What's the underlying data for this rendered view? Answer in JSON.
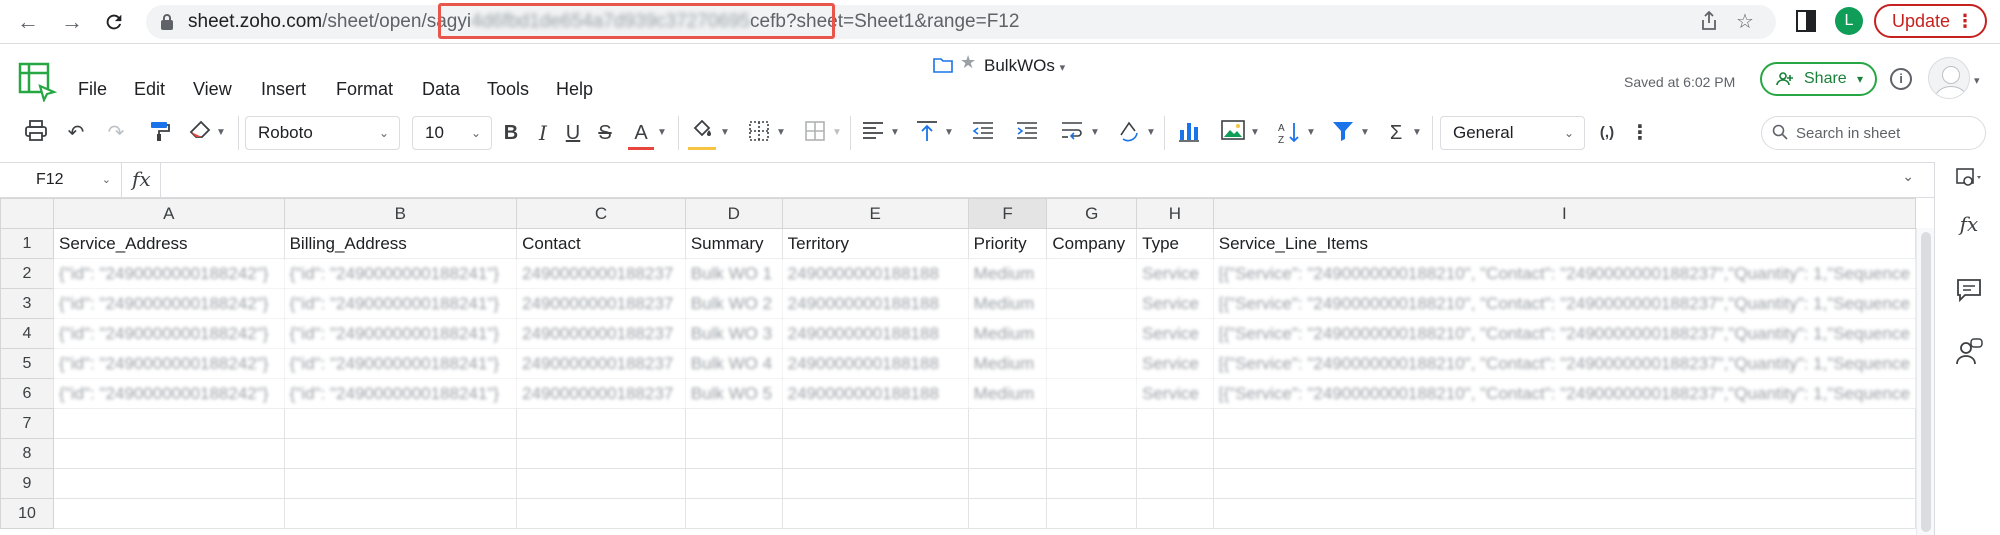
{
  "browser": {
    "url_host": "sheet.zoho.com",
    "url_path": "/sheet/open/",
    "url_id_visible_start": "sagyi",
    "url_id_blurred": "4d6fbd1de654a7d939c37270695",
    "url_id_visible_end": "cefb",
    "url_query": "?sheet=Sheet1&range=F12",
    "profile_initial": "L",
    "update_label": "Update",
    "highlight_color": "#e8564b"
  },
  "app": {
    "doc_title": "BulkWOs",
    "saved_status": "Saved at 6:02 PM",
    "share_label": "Share",
    "brand_color": "#27a744",
    "menu": [
      "File",
      "Edit",
      "View",
      "Insert",
      "Format",
      "Data",
      "Tools",
      "Help"
    ]
  },
  "toolbar": {
    "font_name": "Roboto",
    "font_size": "10",
    "number_format": "General",
    "search_placeholder": "Search in sheet",
    "icons": [
      "print-icon",
      "undo-icon",
      "redo-icon",
      "format-painter-icon",
      "clear-format-icon",
      "bold-icon",
      "italic-icon",
      "underline-icon",
      "strikethrough-icon",
      "text-color-icon",
      "fill-color-icon",
      "borders-icon",
      "merge-cells-icon",
      "align-horizontal-icon",
      "align-vertical-icon",
      "decrease-indent-icon",
      "increase-indent-icon",
      "text-wrap-icon",
      "rotate-text-icon",
      "insert-chart-icon",
      "insert-image-icon",
      "sort-icon",
      "filter-icon",
      "autosum-icon",
      "thousand-separator-icon",
      "more-options-icon"
    ],
    "text_color": "#e8453c",
    "fill_color": "#f6c342"
  },
  "formula_bar": {
    "cell_ref": "F12",
    "fx_label": "fx",
    "value": ""
  },
  "grid": {
    "columns": [
      "A",
      "B",
      "C",
      "D",
      "E",
      "F",
      "G",
      "H",
      "I"
    ],
    "active_column": "F",
    "row_numbers": [
      "1",
      "2",
      "3",
      "4",
      "5",
      "6",
      "7",
      "8",
      "9",
      "10"
    ],
    "headers": [
      "Service_Address",
      "Billing_Address",
      "Contact",
      "Summary",
      "Territory",
      "Priority",
      "Company",
      "Type",
      "Service_Line_Items"
    ],
    "rows": [
      [
        "{\"id\": \"2490000000188242\"}",
        "{\"id\": \"2490000000188241\"}",
        "2490000000188237",
        "Bulk WO 1",
        "2490000000188188",
        "Medium",
        "",
        "Service",
        "[{\"Service\": \"2490000000188210\", \"Contact\": \"2490000000188237\",\"Quantity\": 1,\"Sequence"
      ],
      [
        "{\"id\": \"2490000000188242\"}",
        "{\"id\": \"2490000000188241\"}",
        "2490000000188237",
        "Bulk WO 2",
        "2490000000188188",
        "Medium",
        "",
        "Service",
        "[{\"Service\": \"2490000000188210\", \"Contact\": \"2490000000188237\",\"Quantity\": 1,\"Sequence"
      ],
      [
        "{\"id\": \"2490000000188242\"}",
        "{\"id\": \"2490000000188241\"}",
        "2490000000188237",
        "Bulk WO 3",
        "2490000000188188",
        "Medium",
        "",
        "Service",
        "[{\"Service\": \"2490000000188210\", \"Contact\": \"2490000000188237\",\"Quantity\": 1,\"Sequence"
      ],
      [
        "{\"id\": \"2490000000188242\"}",
        "{\"id\": \"2490000000188241\"}",
        "2490000000188237",
        "Bulk WO 4",
        "2490000000188188",
        "Medium",
        "",
        "Service",
        "[{\"Service\": \"2490000000188210\", \"Contact\": \"2490000000188237\",\"Quantity\": 1,\"Sequence"
      ],
      [
        "{\"id\": \"2490000000188242\"}",
        "{\"id\": \"2490000000188241\"}",
        "2490000000188237",
        "Bulk WO 5",
        "2490000000188188",
        "Medium",
        "",
        "Service",
        "[{\"Service\": \"2490000000188210\", \"Contact\": \"2490000000188237\",\"Quantity\": 1,\"Sequence"
      ]
    ]
  }
}
